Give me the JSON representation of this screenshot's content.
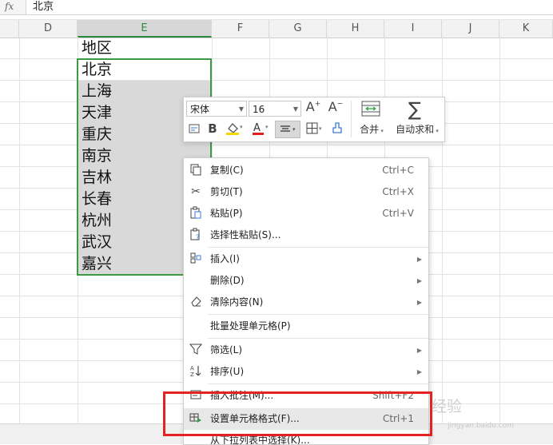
{
  "formula_bar": {
    "fx_label": "fx",
    "value": "北京"
  },
  "columns": [
    "D",
    "E",
    "F",
    "G",
    "H",
    "I",
    "J",
    "K"
  ],
  "selected_column": "E",
  "cells": [
    "地区",
    "北京",
    "上海",
    "天津",
    "重庆",
    "南京",
    "吉林",
    "长春",
    "杭州",
    "武汉",
    "嘉兴"
  ],
  "mini_toolbar": {
    "font_name": "宋体",
    "font_size": "16",
    "merge_label": "合并",
    "autosum_label": "自动求和",
    "font_color": "#e02020",
    "fill_color": "#f2d600"
  },
  "context_menu": {
    "items": [
      {
        "label": "复制(C)",
        "shortcut": "Ctrl+C",
        "icon": "copy-icon"
      },
      {
        "label": "剪切(T)",
        "shortcut": "Ctrl+X",
        "icon": "scissors-icon"
      },
      {
        "label": "粘贴(P)",
        "shortcut": "Ctrl+V",
        "icon": "paste-icon"
      },
      {
        "label": "选择性粘贴(S)...",
        "shortcut": "",
        "icon": "paste-special-icon"
      },
      {
        "label": "插入(I)",
        "shortcut": "",
        "icon": "insert-icon"
      },
      {
        "label": "删除(D)",
        "shortcut": "",
        "icon": ""
      },
      {
        "label": "清除内容(N)",
        "shortcut": "",
        "icon": "eraser-icon"
      },
      {
        "label": "批量处理单元格(P)",
        "shortcut": "",
        "icon": ""
      },
      {
        "label": "筛选(L)",
        "shortcut": "",
        "icon": "filter-icon"
      },
      {
        "label": "排序(U)",
        "shortcut": "",
        "icon": "sort-icon"
      },
      {
        "label": "插入批注(M)...",
        "shortcut": "Shift+F2",
        "icon": "comment-icon"
      },
      {
        "label": "设置单元格格式(F)...",
        "shortcut": "Ctrl+1",
        "icon": "format-cells-icon"
      },
      {
        "label": "从下拉列表中选择(K)...",
        "shortcut": "",
        "icon": ""
      }
    ]
  },
  "watermark": {
    "text": "经验",
    "subtext": "jingyan.baidu.com"
  }
}
